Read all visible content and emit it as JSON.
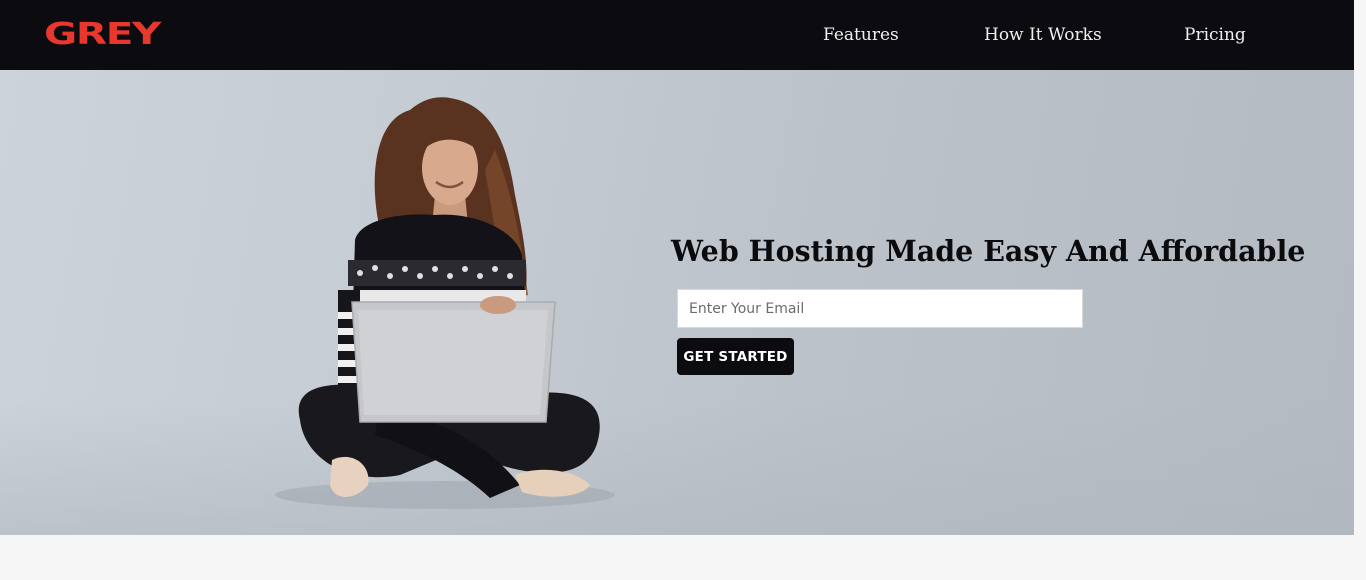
{
  "brand": {
    "logo_text": "GREY",
    "accent_color": "#e8382d",
    "nav_background": "#0c0b10"
  },
  "nav": {
    "links": [
      {
        "label": "Features"
      },
      {
        "label": "How It Works"
      },
      {
        "label": "Pricing"
      }
    ]
  },
  "hero": {
    "image": "woman-with-laptop-photo",
    "title": "Web Hosting Made Easy And Affordable",
    "email_placeholder": "Enter Your Email",
    "email_value": "",
    "cta_label": "GET STARTED"
  }
}
